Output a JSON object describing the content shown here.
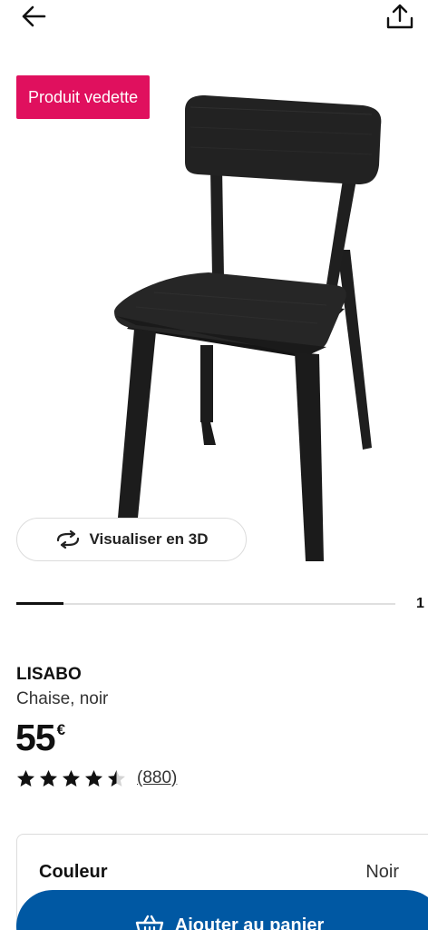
{
  "header": {
    "back_icon": "arrow-left-icon",
    "share_icon": "share-upload-icon"
  },
  "gallery": {
    "badge_label": "Produit vedette",
    "image_subject": "chair-image",
    "view_3d": {
      "icon": "rotate-3d-icon",
      "label": "Visualiser en 3D"
    },
    "progress_fraction": 0.125,
    "image_counter": "1"
  },
  "product": {
    "name": "LISABO",
    "description": "Chaise, noir",
    "price": {
      "amount": "55",
      "currency": "€"
    },
    "rating": {
      "value": 4.5,
      "max": 5,
      "count_label": "(880)"
    }
  },
  "variant": {
    "label": "Couleur",
    "value": "Noir"
  },
  "cta": {
    "icon": "cart-icon",
    "label": "Ajouter au panier"
  },
  "colors": {
    "badge": "#e0105e",
    "primary": "#0058a3",
    "chair": "#222222"
  }
}
